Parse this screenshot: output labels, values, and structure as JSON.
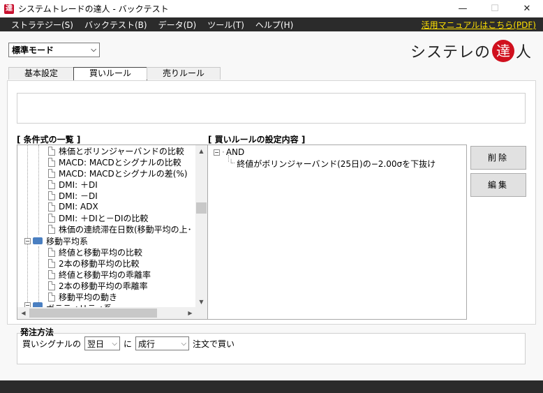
{
  "window": {
    "title": "システムトレードの達人 - バックテスト",
    "app_icon_glyph": "達",
    "minimize": "—",
    "maximize": "☐",
    "close": "✕"
  },
  "menu": {
    "items": [
      "ストラテジー(S)",
      "バックテスト(B)",
      "データ(D)",
      "ツール(T)",
      "ヘルプ(H)"
    ],
    "manual_link": "活用マニュアルはこちら(PDF)"
  },
  "mode": {
    "selected": "標準モード"
  },
  "logo": {
    "left": "システレの",
    "circle": "達",
    "right": "人"
  },
  "tabs": [
    "基本設定",
    "買いルール",
    "売りルール"
  ],
  "active_tab": 1,
  "conditions": {
    "header": "[ 条件式の一覧 ]",
    "items": [
      "株価とボリンジャーバンドの比較",
      "MACD: MACDとシグナルの比較",
      "MACD: MACDとシグナルの差(%)",
      "DMI: ＋DI",
      "DMI: －DI",
      "DMI: ADX",
      "DMI: ＋DIと－DIの比較",
      "株価の連続滞在日数(移動平均の上･"
    ],
    "group": "移動平均系",
    "group_items": [
      "終値と移動平均の比較",
      "2本の移動平均の比較",
      "終値と移動平均の乖離率",
      "2本の移動平均の乖離率",
      "移動平均の動き"
    ],
    "partial_group": "ボラティリティ系"
  },
  "rules": {
    "header": "[ 買いルールの設定内容 ]",
    "root": "AND",
    "children": [
      "終値がボリンジャーバンド(25日)の−2.00σを下抜け"
    ]
  },
  "buttons": {
    "delete": "削除",
    "edit": "編集"
  },
  "order": {
    "title": "発注方法",
    "signal_label": "買いシグナルの",
    "timing": "翌日",
    "ni": "に",
    "type": "成行",
    "suffix": "注文で買い"
  }
}
